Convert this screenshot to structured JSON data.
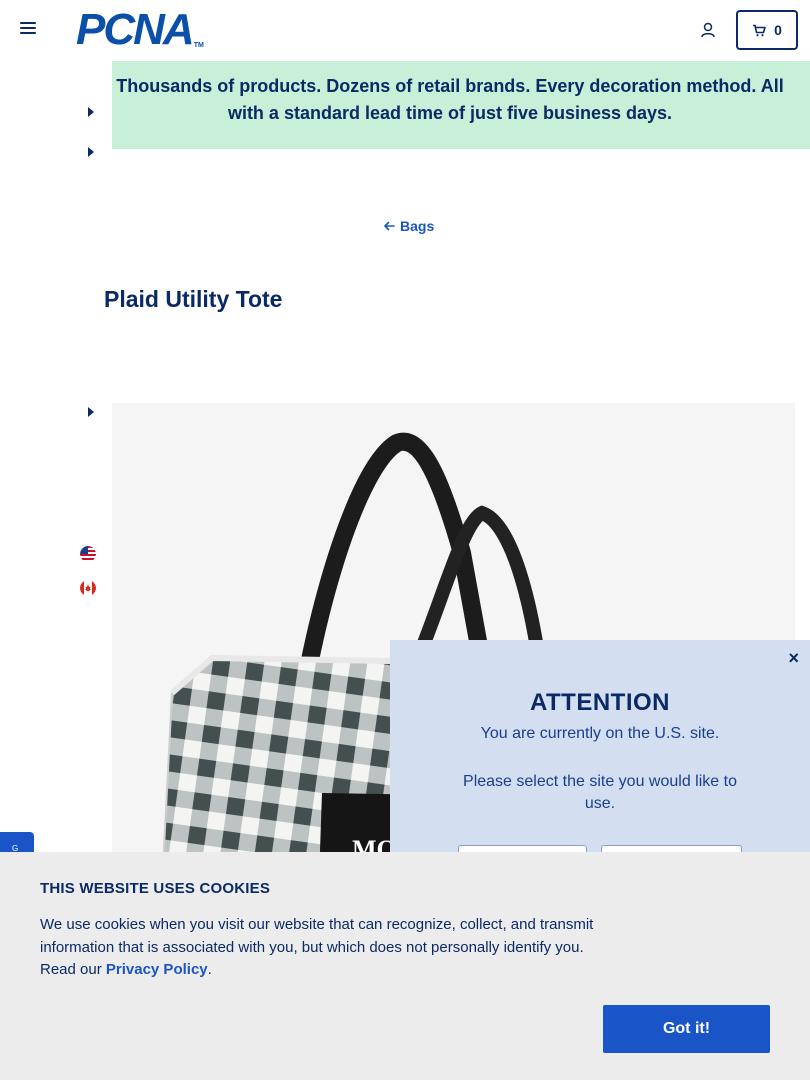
{
  "header": {
    "logo_text": "PCNA",
    "logo_tm": "TM",
    "cart_count": "0"
  },
  "banner": {
    "text": "Thousands of products. Dozens of retail brands. Every decoration method. All with a standard lead time of just five business days."
  },
  "nav": {
    "back_label": "Bags"
  },
  "product": {
    "title": "Plaid Utility Tote",
    "print_text": "MO"
  },
  "attention": {
    "title": "ATTENTION",
    "message": "You are currently on the U.S. site.",
    "prompt": "Please select the site you would like to use.",
    "close_label": "×"
  },
  "side_tab": {
    "label": "G"
  },
  "cookie": {
    "title": "THIS WEBSITE USES COOKIES",
    "text": "We use cookies when you visit our website that can recognize, collect, and transmit information that is associated with you, but which does not personally identify you. Read our",
    "link_label": "Privacy Policy",
    "period": ".",
    "button_label": "Got it!"
  },
  "colors": {
    "brand_blue": "#0a4fa8",
    "navy": "#0a2a66",
    "accent": "#1a55c8",
    "banner_bg": "#c8efd8",
    "modal_bg": "#d3def0"
  },
  "icons": [
    "hamburger-icon",
    "account-icon",
    "cart-icon",
    "arrow-left-icon",
    "caret-right-icon",
    "us-flag-icon",
    "canada-flag-icon",
    "close-icon"
  ]
}
